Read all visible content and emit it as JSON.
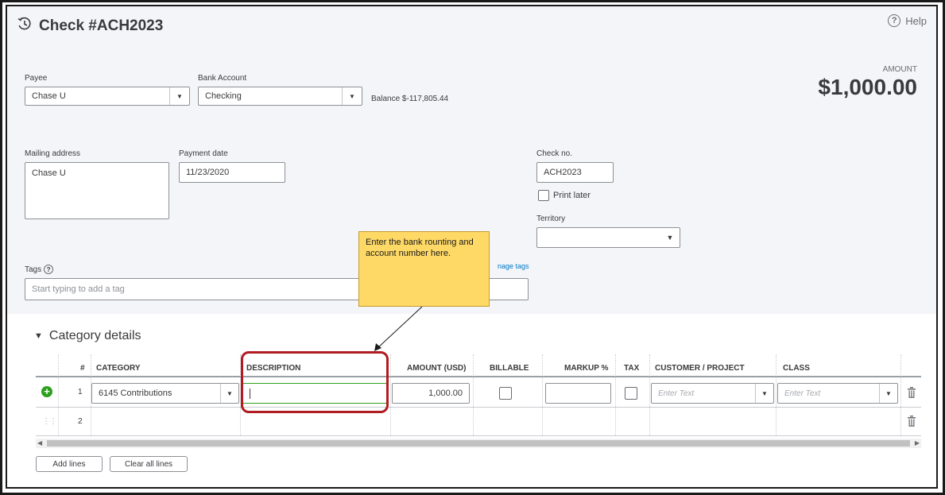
{
  "header": {
    "title": "Check #ACH2023",
    "help_label": "Help",
    "title_icon": "recent-transactions-icon"
  },
  "form": {
    "payee": {
      "label": "Payee",
      "value": "Chase U"
    },
    "bank_account": {
      "label": "Bank Account",
      "value": "Checking"
    },
    "balance_label": "Balance",
    "balance_value": "$-117,805.44",
    "amount_label": "AMOUNT",
    "amount_value": "$1,000.00",
    "mailing_address": {
      "label": "Mailing address",
      "value": "Chase U"
    },
    "payment_date": {
      "label": "Payment date",
      "value": "11/23/2020"
    },
    "check_no": {
      "label": "Check no.",
      "value": "ACH2023"
    },
    "print_later_label": "Print later",
    "territory": {
      "label": "Territory",
      "value": ""
    },
    "tags": {
      "label": "Tags",
      "placeholder": "Start typing to add a tag",
      "manage_link": "nage tags"
    }
  },
  "callout": {
    "text": "Enter the bank rounting and account number here."
  },
  "category_details": {
    "title": "Category details",
    "columns": [
      "#",
      "CATEGORY",
      "DESCRIPTION",
      "AMOUNT (USD)",
      "BILLABLE",
      "MARKUP %",
      "TAX",
      "CUSTOMER / PROJECT",
      "CLASS"
    ],
    "rows": [
      {
        "num": "1",
        "category": "6145 Contributions",
        "description": "",
        "amount": "1,000.00",
        "customer_placeholder": "Enter Text",
        "class_placeholder": "Enter Text"
      },
      {
        "num": "2"
      }
    ],
    "add_lines_label": "Add lines",
    "clear_lines_label": "Clear all lines"
  },
  "colors": {
    "accent_green": "#2ca01c",
    "highlight_red": "#b01c21",
    "callout_yellow": "#ffd966"
  }
}
